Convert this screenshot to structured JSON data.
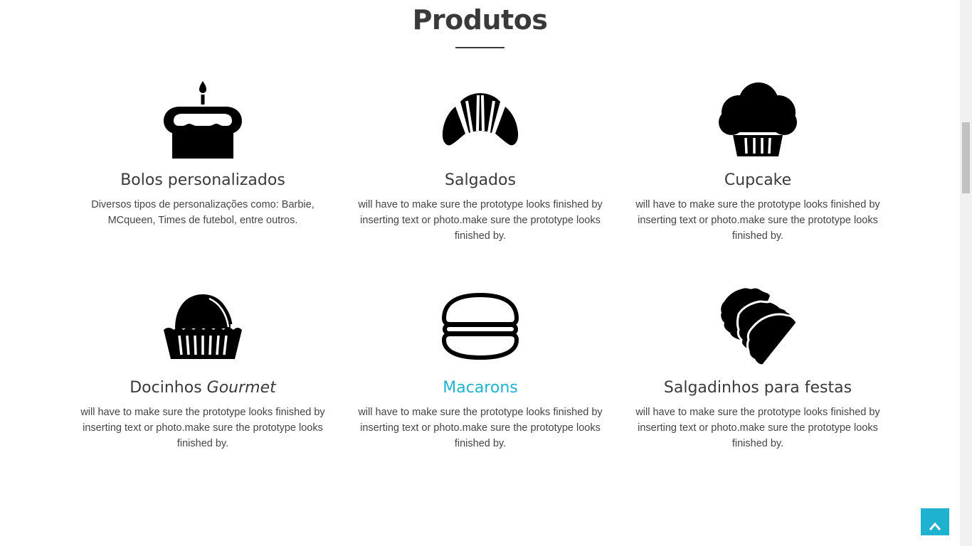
{
  "section": {
    "title": "Produtos"
  },
  "products": [
    {
      "name": "Bolos personalizados",
      "icon": "cake-icon",
      "description": "Diversos tipos de personalizações como: Barbie, MCqueen, Times de futebol, entre outros."
    },
    {
      "name": "Salgados",
      "icon": "croissant-icon",
      "description": "will have to make sure the prototype looks finished by inserting text or photo.make sure the prototype looks finished by."
    },
    {
      "name": "Cupcake",
      "icon": "cupcake-icon",
      "description": "will have to make sure the prototype looks finished by inserting text or photo.make sure the prototype looks finished by."
    },
    {
      "name_main": "Docinhos ",
      "name_italic": "Gourmet",
      "icon": "bonbon-icon",
      "description": "will have to make sure the prototype looks finished by inserting text or photo.make sure the prototype looks finished by."
    },
    {
      "name": "Macarons",
      "icon": "macaron-icon",
      "description": "will have to make sure the prototype looks finished by inserting text or photo.make sure the prototype looks finished by."
    },
    {
      "name": "Salgadinhos para festas",
      "icon": "empanada-icon",
      "description": "will have to make sure the prototype looks finished by inserting text or photo.make sure the prototype looks finished by."
    }
  ],
  "colors": {
    "heading": "#3a3a3a",
    "accent": "#1fb2d0",
    "text": "#444444"
  },
  "controls": {
    "back_to_top_icon": "chevron-up-icon"
  }
}
